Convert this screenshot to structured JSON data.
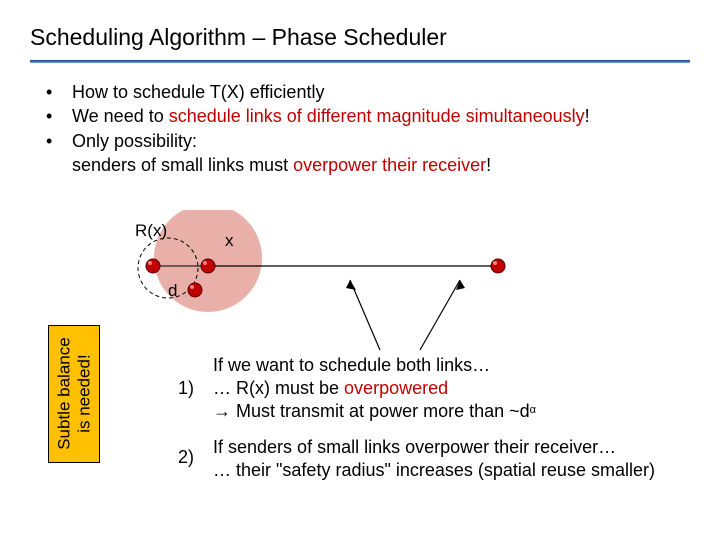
{
  "title": "Scheduling Algorithm – Phase Scheduler",
  "bullets": {
    "b1": "How to schedule T(X) efficiently",
    "b2_pre": "We need to ",
    "b2_red": "schedule links of different magnitude simultaneously",
    "b2_post": "!",
    "b3": "Only possibility:",
    "b3_sub_pre": "senders of small links must ",
    "b3_sub_red": "overpower their receiver",
    "b3_sub_post": "!"
  },
  "diagram": {
    "rx_label": "R(x)",
    "node_x": "x",
    "d_label": "d"
  },
  "balance": {
    "line1": "Subtle balance",
    "line2": "is needed!"
  },
  "point1": {
    "num": "1)",
    "l1": "If we want to schedule both links…",
    "l2_pre": "… R(x) must be ",
    "l2_red": "overpowered",
    "l3_arrow": "→ ",
    "l3_text": "Must transmit at power more than ~d",
    "l3_sup": "α"
  },
  "point2": {
    "num": "2)",
    "l1": "If senders of small links overpower their receiver…",
    "l2": "… their \"safety radius\" increases (spatial reuse smaller)"
  }
}
